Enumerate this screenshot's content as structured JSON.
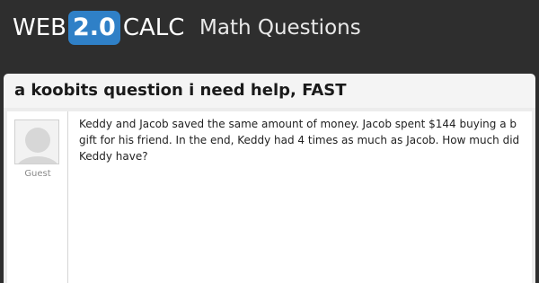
{
  "header": {
    "logo": {
      "prefix": "WEB",
      "badge": "2.0",
      "suffix": "CALC"
    },
    "section_title": "Math Questions"
  },
  "question": {
    "title": "a koobits question i need help, FAST",
    "author": "Guest",
    "body_lines": [
      "Keddy and Jacob saved the same amount of money. Jacob spent $144 buying a b",
      "gift for his friend. In the end, Keddy had 4 times as much as Jacob. How much did",
      "Keddy have?"
    ]
  },
  "colors": {
    "background": "#2e2e2e",
    "logo_badge": "#2f80c7",
    "title_bar": "#f4f4f4",
    "post_background": "#ffffff"
  },
  "icons": {
    "avatar": "user-silhouette-icon"
  }
}
